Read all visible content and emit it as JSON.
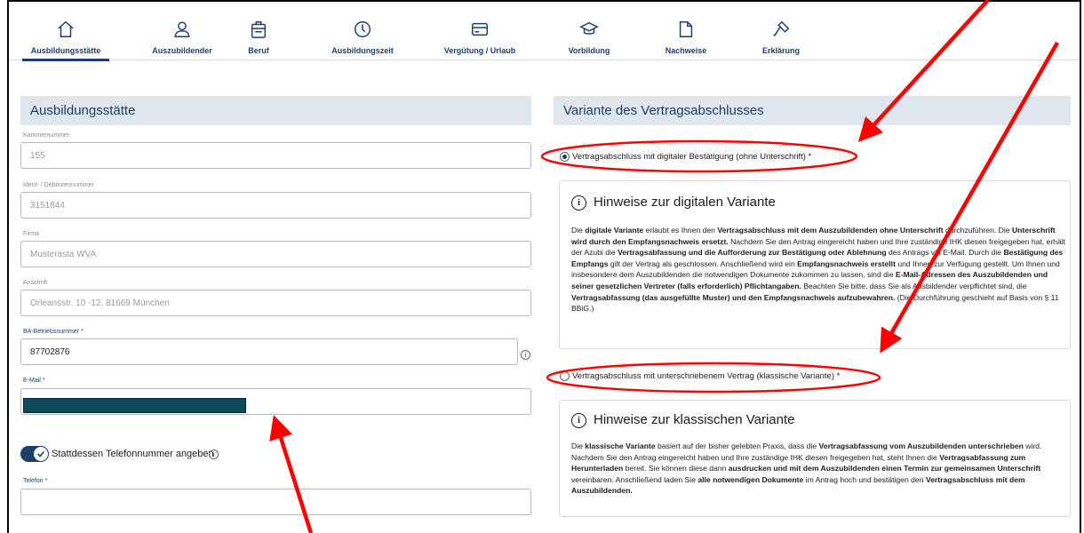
{
  "nav": {
    "items": [
      {
        "label": "Ausbildungsstätte",
        "icon": "home-icon"
      },
      {
        "label": "Auszubildender",
        "icon": "user-icon"
      },
      {
        "label": "Beruf",
        "icon": "briefcase-icon"
      },
      {
        "label": "Ausbildungszeit",
        "icon": "clock-icon"
      },
      {
        "label": "Vergütung / Urlaub",
        "icon": "card-icon"
      },
      {
        "label": "Vorbildung",
        "icon": "graduation-cap-icon"
      },
      {
        "label": "Nachweise",
        "icon": "document-icon"
      },
      {
        "label": "Erklärung",
        "icon": "gavel-icon"
      }
    ],
    "active": "Ausbildungsstätte"
  },
  "left": {
    "section_title": "Ausbildungsstätte",
    "fields": {
      "kammernummer": {
        "label": "Kammernummer",
        "value": "155"
      },
      "ident": {
        "label": "Ident- / Debitorennummer",
        "value": "3151844"
      },
      "firma": {
        "label": "Firma",
        "value": "Musterasta WVA"
      },
      "anschrift": {
        "label": "Anschrift",
        "value": "Orleansstr. 10 -12, 81669 München"
      },
      "ba": {
        "label": "BA-Betriebsnummer *",
        "value": "87702876"
      },
      "email": {
        "label": "E-Mail *",
        "value": ""
      },
      "telefon": {
        "label": "Telefon *",
        "value": ""
      }
    },
    "toggle_label": "Stattdessen Telefonnummer angeben"
  },
  "right": {
    "section_title": "Variante des Vertragsabschlusses",
    "radio_digital": "Vertragsabschluss mit digitaler Bestätigung (ohne Unterschrift) *",
    "radio_classic": "Vertragsabschluss mit unterschriebenem Vertrag (klassische Variante) *",
    "hint_digital_title": "Hinweise zur digitalen Variante",
    "hint_classic_title": "Hinweise zur klassischen Variante"
  },
  "colors": {
    "primary": "#1c3f6e",
    "section_bg": "#dfe6ee",
    "annotation_red": "#ff0000",
    "redaction": "#0f4a5c"
  }
}
